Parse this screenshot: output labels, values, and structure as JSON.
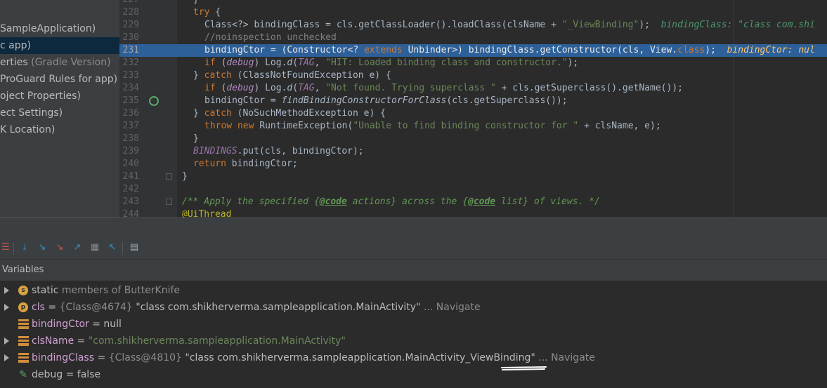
{
  "project": {
    "items": [
      {
        "text": " SampleApplication)",
        "hint": ""
      },
      {
        "text": "c app)",
        "hint": ""
      },
      {
        "text": "erties",
        "hint": " (Gradle Version)"
      },
      {
        "text": "ProGuard Rules for app)",
        "hint": ""
      },
      {
        "text": "oject Properties)",
        "hint": ""
      },
      {
        "text": "ect Settings)",
        "hint": ""
      },
      {
        "text": "K Location)",
        "hint": ""
      }
    ]
  },
  "editor": {
    "line_numbers": [
      "227",
      "228",
      "229",
      "230",
      "231",
      "232",
      "233",
      "234",
      "235",
      "236",
      "237",
      "238",
      "239",
      "240",
      "241",
      "242",
      "243",
      "244"
    ],
    "tokens": {
      "try": "try",
      "l229_code": "Class<?> bindingClass = cls.getClassLoader().loadClass(clsName + ",
      "l229_str": "\"_ViewBinding\"",
      "l229_end": ");",
      "l229_inline": "bindingClass: \"class com.shi",
      "l230": "//noinspection unchecked",
      "l231_a": "bindingCtor = (Constructor<? ",
      "l231_extends": "extends",
      "l231_b": " Unbinder>) bindingClass.getConstructor(cls, View.",
      "l231_class": "class",
      "l231_c": ");",
      "l231_inline": "bindingCtor: nul",
      "if": "if",
      "debug": "debug",
      "log": "Log.",
      "d": "d",
      "tag": "TAG",
      "l232_str": "\"HIT: Loaded binding class and constructor.\"",
      "l233_a": "} ",
      "catch": "catch",
      "l233_b": " (ClassNotFoundException e) {",
      "l234_str": "\"Not found. Trying superclass \"",
      "l234_b": " + cls.getSuperclass().getName());",
      "l235_a": "bindingCtor = ",
      "l235_fn": "findBindingConstructorForClass",
      "l235_b": "(cls.getSuperclass());",
      "l236_b": " (NoSuchMethodException e) {",
      "throw": "throw",
      "new": "new",
      "l237_a": " RuntimeException(",
      "l237_str": "\"Unable to find binding constructor for \"",
      "l237_b": " + clsName, e);",
      "l238": "}",
      "bindings": "BINDINGS",
      "l239_b": ".put(cls, bindingCtor);",
      "return": "return",
      "l240_b": " bindingCtor;",
      "l241": "}",
      "l243_a": "/** Apply the specified {",
      "l243_code1": "@code",
      "l243_b": " actions} across the {",
      "l243_code2": "@code",
      "l243_c": " list} of views. */",
      "l244": "@UiThread"
    }
  },
  "debugger": {
    "toolbar_icons": [
      "show-execution-point-icon",
      "step-over-icon",
      "step-into-icon",
      "force-step-into-icon",
      "step-out-icon",
      "drop-frame-icon",
      "run-to-cursor-icon",
      "evaluate-expression-icon"
    ],
    "variables_title": "Variables",
    "variables": [
      {
        "icon": "s",
        "name": "static",
        "eq": "",
        "prefix": "",
        "value": " members of ButterKnife",
        "suffix": "",
        "nav": "",
        "expandable": true
      },
      {
        "icon": "p",
        "name": "cls",
        "eq": " = ",
        "prefix": "{Class@4674}",
        "value": " \"class com.shikherverma.sampleapplication.MainActivity\"",
        "suffix": " ... ",
        "nav": "Navigate",
        "expandable": true
      },
      {
        "icon": "f",
        "name": "bindingCtor",
        "eq": " = ",
        "prefix": "",
        "value": "null",
        "suffix": "",
        "nav": "",
        "expandable": false
      },
      {
        "icon": "f",
        "name": "clsName",
        "eq": " = ",
        "prefix": "",
        "value": "\"com.shikherverma.sampleapplication.MainActivity\"",
        "suffix": "",
        "nav": "",
        "expandable": true
      },
      {
        "icon": "f",
        "name": "bindingClass",
        "eq": " = ",
        "prefix": "{Class@4810}",
        "value": " \"class com.shikherverma.sampleapplication.MainActivity_ViewBinding\"",
        "suffix": " ... ",
        "nav": "Navigate",
        "expandable": true
      },
      {
        "icon": "w",
        "name": "debug",
        "eq": " = ",
        "prefix": "",
        "value": "false",
        "suffix": "",
        "nav": "",
        "expandable": false
      }
    ]
  },
  "colors": {
    "highlight_line": "#2d6099",
    "keyword": "#cc7832",
    "string": "#6a8759",
    "background": "#2b2b2b"
  }
}
